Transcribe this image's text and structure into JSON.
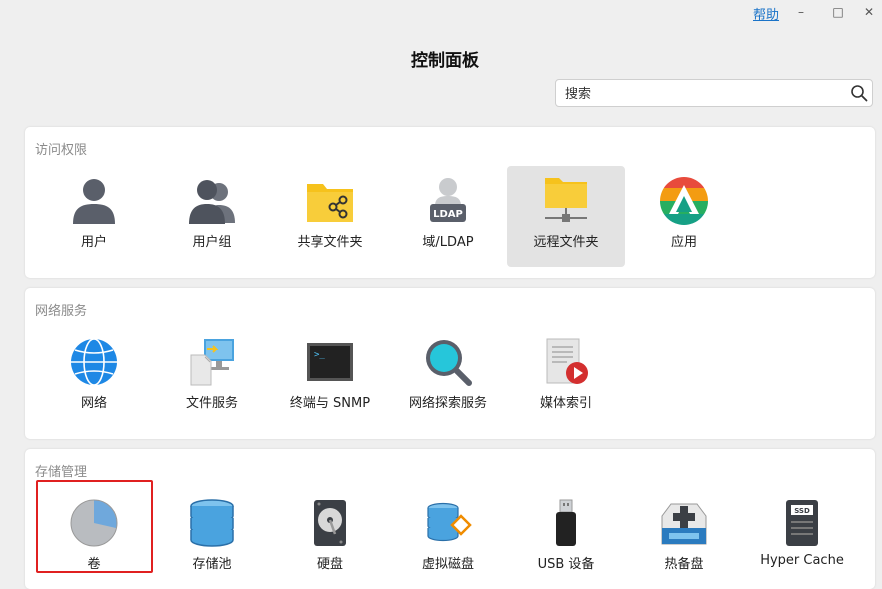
{
  "window": {
    "help_label": "帮助",
    "minimize_glyph": "–",
    "maximize_glyph": "□",
    "close_glyph": "✕"
  },
  "header": {
    "title": "控制面板"
  },
  "search": {
    "placeholder": "搜索",
    "value": ""
  },
  "sections": {
    "access": {
      "title": "访问权限",
      "items": [
        {
          "label": "用户",
          "icon": "user-icon"
        },
        {
          "label": "用户组",
          "icon": "user-group-icon"
        },
        {
          "label": "共享文件夹",
          "icon": "shared-folder-icon"
        },
        {
          "label": "域/LDAP",
          "icon": "ldap-icon",
          "icon_text": "LDAP"
        },
        {
          "label": "远程文件夹",
          "icon": "remote-folder-icon",
          "selected": true
        },
        {
          "label": "应用",
          "icon": "app-icon"
        }
      ]
    },
    "network": {
      "title": "网络服务",
      "items": [
        {
          "label": "网络",
          "icon": "globe-icon"
        },
        {
          "label": "文件服务",
          "icon": "file-service-icon"
        },
        {
          "label": "终端与 SNMP",
          "icon": "terminal-icon",
          "icon_text": ">_"
        },
        {
          "label": "网络探索服务",
          "icon": "magnifier-icon"
        },
        {
          "label": "媒体索引",
          "icon": "media-index-icon"
        }
      ]
    },
    "storage": {
      "title": "存储管理",
      "items": [
        {
          "label": "卷",
          "icon": "volume-pie-icon",
          "highlighted": true
        },
        {
          "label": "存储池",
          "icon": "storage-pool-icon"
        },
        {
          "label": "硬盘",
          "icon": "hard-disk-icon"
        },
        {
          "label": "虚拟磁盘",
          "icon": "virtual-disk-icon"
        },
        {
          "label": "USB 设备",
          "icon": "usb-device-icon"
        },
        {
          "label": "热备盘",
          "icon": "hot-spare-icon"
        },
        {
          "label": "Hyper Cache",
          "icon": "ssd-cache-icon",
          "icon_text": "SSD"
        }
      ]
    }
  },
  "colors": {
    "accent_link": "#1a73c8",
    "selected_bg": "#e3e3e3",
    "highlight_border": "#e02020",
    "folder_yellow": "#f6c21c",
    "user_gray": "#5a5f6a"
  }
}
